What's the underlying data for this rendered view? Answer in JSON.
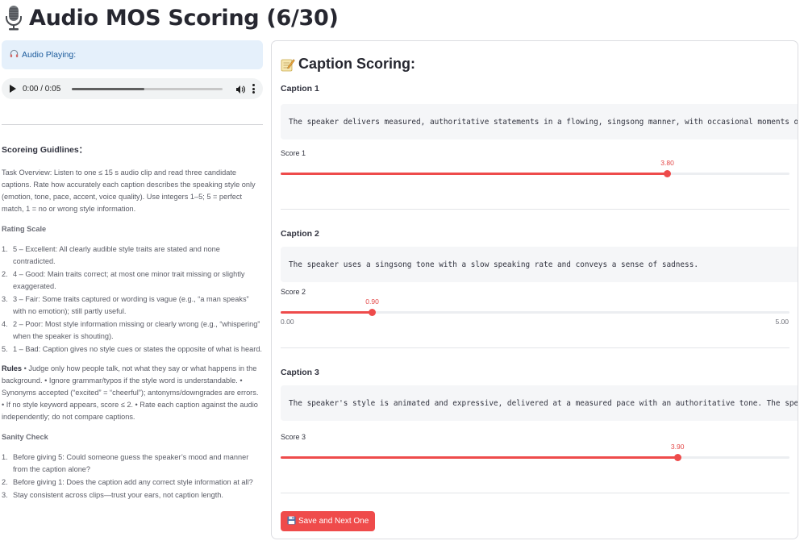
{
  "page": {
    "title": "Audio MOS Scoring (6/30)",
    "title_icon": "microphone-icon"
  },
  "audio": {
    "banner": "Audio Playing:",
    "banner_icon": "headphones-icon",
    "time": "0:00 / 0:05",
    "progress": 0.48
  },
  "guidelines": {
    "heading": "Scoreing Guidlines：",
    "overview": "Task Overview: Listen to one ≤ 15 s audio clip and read three candidate captions. Rate how accurately each caption describes the speaking style only (emotion, tone, pace, accent, voice quality). Use integers 1–5; 5 = perfect match, 1 = no or wrong style information.",
    "rating_scale_title": "Rating Scale",
    "rating_scale": [
      {
        "num": "1.",
        "text": "5 – Excellent: All clearly audible style traits are stated and none contradicted."
      },
      {
        "num": "2.",
        "text": "4 – Good: Main traits correct; at most one minor trait missing or slightly exaggerated."
      },
      {
        "num": "3.",
        "text": "3 – Fair: Some traits captured or wording is vague (e.g., “a man speaks” with no emotion); still partly useful."
      },
      {
        "num": "4.",
        "text": "2 – Poor: Most style information missing or clearly wrong (e.g., “whispering” when the speaker is shouting)."
      },
      {
        "num": "5.",
        "text": "1 – Bad: Caption gives no style cues or states the opposite of what is heard."
      }
    ],
    "rules_label": "Rules",
    "rules_text": " • Judge only how people talk, not what they say or what happens in the background. • Ignore grammar/typos if the style word is understandable. • Synonyms accepted (“excited” = “cheerful”); antonyms/downgrades are errors. • If no style keyword appears, score ≤ 2. • Rate each caption against the audio independently; do not compare captions.",
    "sanity_title": "Sanity Check",
    "sanity": [
      {
        "num": "1.",
        "text": "Before giving 5: Could someone guess the speaker’s mood and manner from the caption alone?"
      },
      {
        "num": "2.",
        "text": "Before giving 1: Does the caption add any correct style information at all?"
      },
      {
        "num": "3.",
        "text": "Stay consistent across clips—trust your ears, not caption length."
      }
    ]
  },
  "scoring": {
    "heading": "Caption Scoring:",
    "heading_icon": "memo-icon",
    "min_label": "0.00",
    "max_label": "5.00",
    "min": 0,
    "max": 5,
    "captions": [
      {
        "title": "Caption 1",
        "text": "The speaker delivers measured, authoritative statements in a flowing, singsong manner, with occasional moments of",
        "score_label": "Score 1",
        "value": 3.8,
        "value_label": "3.80"
      },
      {
        "title": "Caption 2",
        "text": "The speaker uses a singsong tone with a slow speaking rate and conveys a sense of sadness.",
        "score_label": "Score 2",
        "value": 0.9,
        "value_label": "0.90"
      },
      {
        "title": "Caption 3",
        "text": "The speaker's style is animated and expressive, delivered at a measured pace with an authoritative tone. The spe",
        "score_label": "Score 3",
        "value": 3.9,
        "value_label": "3.90"
      }
    ],
    "save_label": "Save and Next One",
    "save_icon": "floppy-disk-icon",
    "accent_color": "#ee4b4b"
  }
}
